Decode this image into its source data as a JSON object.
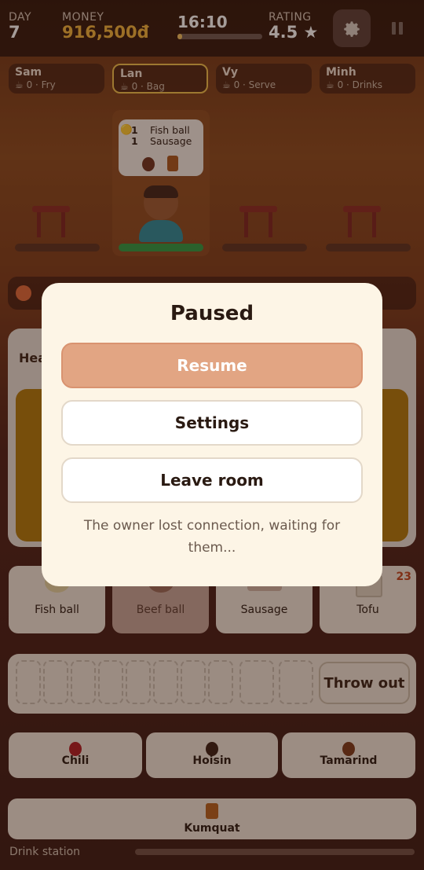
{
  "hud": {
    "day_label": "DAY",
    "day": "7",
    "money_label": "MONEY",
    "money": "916,500đ",
    "time": "16:10",
    "time_progress": 0.06,
    "rating_label": "RATING",
    "rating": "4.5"
  },
  "staff": [
    {
      "name": "Sam",
      "task": "0 · Fry"
    },
    {
      "name": "Lan",
      "task": "0 · Bag"
    },
    {
      "name": "Vy",
      "task": "0 · Serve"
    },
    {
      "name": "Minh",
      "task": "0 · Drinks"
    }
  ],
  "order": {
    "items": [
      {
        "qty": "1",
        "name": "Fish ball"
      },
      {
        "qty": "1",
        "name": "Sausage"
      }
    ]
  },
  "panel": {
    "heading_partial": "Hea"
  },
  "ingredients": [
    {
      "name": "Fish ball"
    },
    {
      "name": "Beef ball"
    },
    {
      "name": "Sausage"
    },
    {
      "name": "Tofu",
      "count": "23"
    }
  ],
  "basket": {
    "throw_label": "Throw out"
  },
  "sauces": [
    {
      "name": "Chili"
    },
    {
      "name": "Hoisin"
    },
    {
      "name": "Tamarind"
    }
  ],
  "drink": {
    "name": "Kumquat",
    "station_label": "Drink station"
  },
  "pause": {
    "title": "Paused",
    "resume": "Resume",
    "settings": "Settings",
    "leave": "Leave room",
    "message": "The owner lost connection, waiting for them..."
  },
  "colors": {
    "accent": "#e2a583",
    "money": "#f1b43b",
    "selected_outline": "#f2c14c"
  }
}
